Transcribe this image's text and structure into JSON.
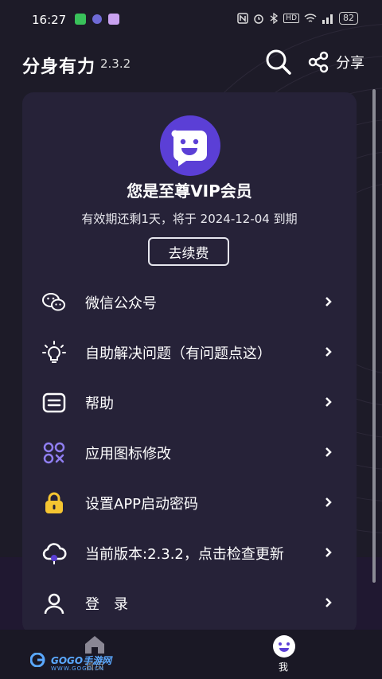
{
  "status_bar": {
    "time": "16:27",
    "icons": [
      "nfc-icon",
      "alarm-icon",
      "bluetooth-icon",
      "hd-icon",
      "wifi-icon",
      "signal-icon"
    ],
    "hd": "HD",
    "battery": "82"
  },
  "header": {
    "title": "分身有力",
    "version": "2.3.2",
    "share_label": "分享"
  },
  "vip_card": {
    "title": "您是至尊VIP会员",
    "expire_text": "有效期还剩1天，将于 2024-12-04 到期",
    "renew_label": "去续费"
  },
  "menu": [
    {
      "label": "微信公众号",
      "icon": "wechat-icon"
    },
    {
      "label": "自助解决问题（有问题点这）",
      "icon": "lightbulb-icon"
    },
    {
      "label": "帮助",
      "icon": "help-document-icon"
    },
    {
      "label": "应用图标修改",
      "icon": "app-icon-edit-icon"
    },
    {
      "label": "设置APP启动密码",
      "icon": "lock-icon"
    },
    {
      "label": "当前版本:2.3.2，点击检查更新",
      "icon": "cloud-update-icon"
    },
    {
      "label": "登　录",
      "icon": "user-icon"
    }
  ],
  "bottom_nav": {
    "home_label": "首页",
    "me_label": "我"
  },
  "watermark": {
    "text": "GOGO手游网",
    "sub": "WWW.GOGO.CN"
  },
  "colors": {
    "accent_purple": "#5b3fd6",
    "lock_yellow": "#f5c531",
    "background": "#1d1b28",
    "card": "#262238"
  }
}
